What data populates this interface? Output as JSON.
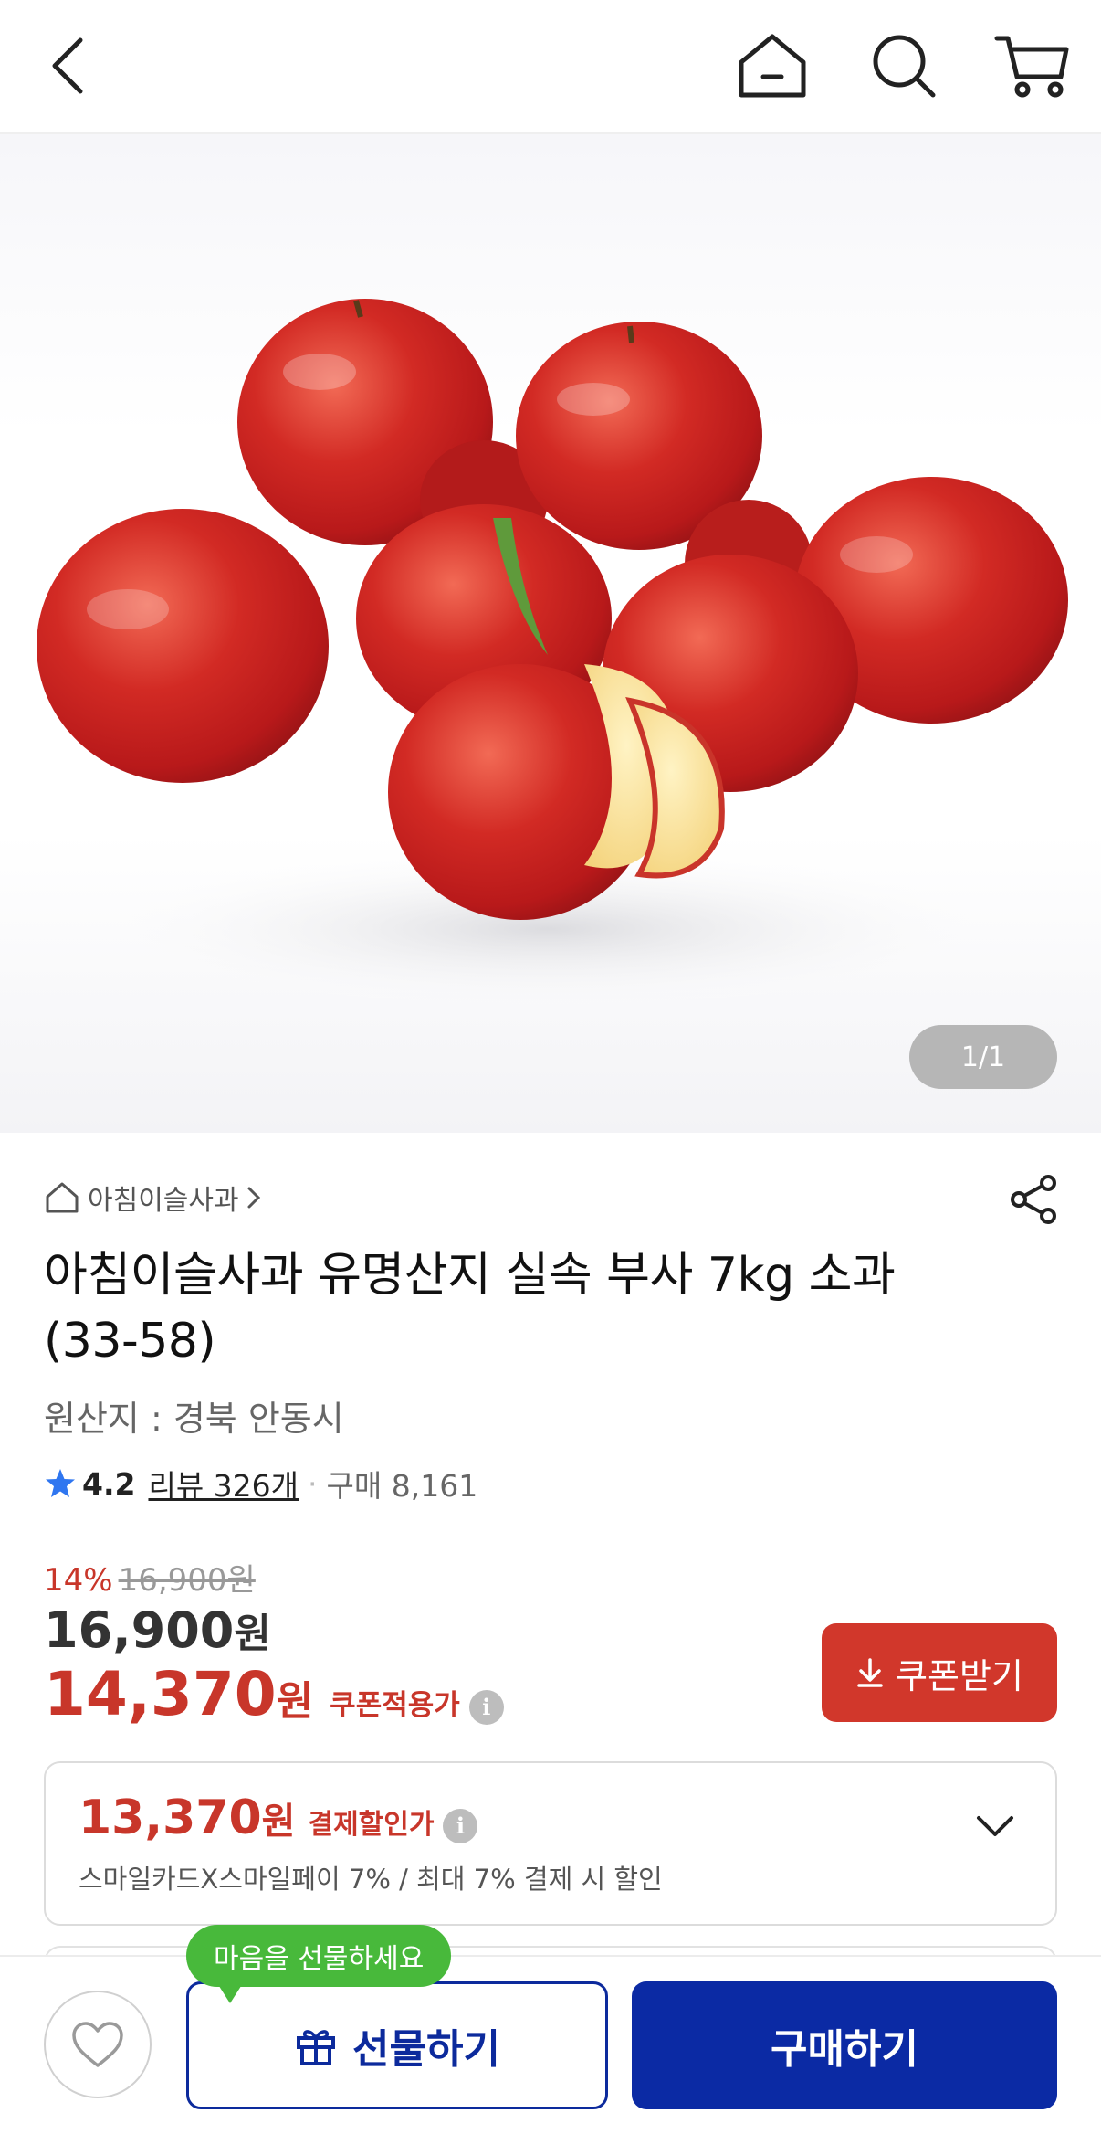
{
  "header": {
    "back_icon": "chevron-left-icon",
    "home_icon": "home-icon",
    "search_icon": "search-icon",
    "cart_icon": "cart-icon"
  },
  "gallery": {
    "image_alt": "red apples product photo",
    "pager": "1/1"
  },
  "product": {
    "store_name": "아침이슬사과",
    "title": "아침이슬사과 유명산지 실속 부사 7kg 소과 (33-58)",
    "origin": "원산지 : 경북 안동시",
    "rating": "4.2",
    "review_link": "리뷰 326개",
    "purchase_count": "구매 8,161"
  },
  "pricing": {
    "discount_rate": "14%",
    "original_price": "16,900원",
    "price_number": "16,900",
    "price_unit": "원",
    "coupon_price_number": "14,370",
    "coupon_price_unit": "원",
    "coupon_label": "쿠폰적용가",
    "coupon_button": "쿠폰받기"
  },
  "payment_discount": {
    "price_number": "13,370",
    "price_unit": "원",
    "label": "결제할인가",
    "description": "스마일카드X스마일페이 7% / 최대 7% 결제 시 할인"
  },
  "bottom_bar": {
    "tooltip": "마음을 선물하세요",
    "gift_button": "선물하기",
    "buy_button": "구매하기"
  },
  "colors": {
    "accent_red": "#d1372b",
    "brand_blue": "#0b2aa4",
    "tooltip_green": "#48b93b"
  }
}
